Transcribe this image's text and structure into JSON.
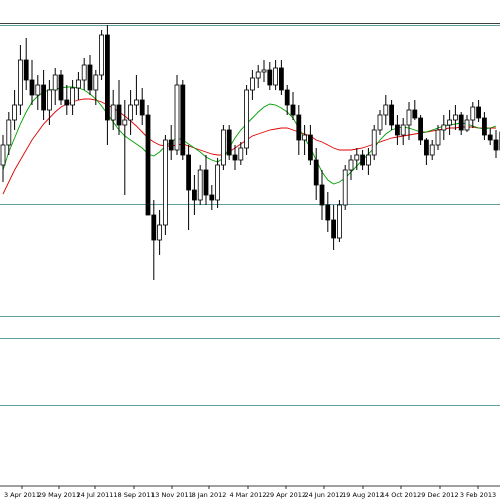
{
  "chart_data": {
    "type": "candlestick",
    "title": "",
    "xlabel": "",
    "ylabel": "",
    "grid": false,
    "legend": "none",
    "indicators": [
      {
        "kind": "moving-average",
        "color": "#00a000"
      },
      {
        "kind": "moving-average",
        "color": "#e00000"
      }
    ],
    "x_tick_labels": [
      "3 Apr 2011",
      "29 May 2011",
      "24 Jul 2011",
      "18 Sep 2011",
      "13 Nov 2011",
      "8 Jan 2012",
      "4 Mar 2012",
      "29 Apr 2012",
      "24 Jun 2012",
      "19 Aug 2012",
      "14 Oct 2012",
      "9 Dec 2012",
      "3 Feb 2013"
    ],
    "ylim": [
      0,
      500
    ],
    "panel_levels": [
      477,
      475,
      296,
      184,
      162,
      95
    ],
    "candles": [
      {
        "o": 335,
        "h": 365,
        "l": 318,
        "c": 355
      },
      {
        "o": 355,
        "h": 388,
        "l": 345,
        "c": 380
      },
      {
        "o": 380,
        "h": 410,
        "l": 370,
        "c": 395
      },
      {
        "o": 395,
        "h": 455,
        "l": 385,
        "c": 440
      },
      {
        "o": 440,
        "h": 462,
        "l": 410,
        "c": 420
      },
      {
        "o": 420,
        "h": 440,
        "l": 395,
        "c": 405
      },
      {
        "o": 405,
        "h": 425,
        "l": 390,
        "c": 415
      },
      {
        "o": 415,
        "h": 430,
        "l": 380,
        "c": 390
      },
      {
        "o": 390,
        "h": 420,
        "l": 375,
        "c": 410
      },
      {
        "o": 410,
        "h": 432,
        "l": 395,
        "c": 425
      },
      {
        "o": 425,
        "h": 430,
        "l": 395,
        "c": 400
      },
      {
        "o": 400,
        "h": 415,
        "l": 385,
        "c": 395
      },
      {
        "o": 395,
        "h": 420,
        "l": 385,
        "c": 412
      },
      {
        "o": 412,
        "h": 428,
        "l": 400,
        "c": 420
      },
      {
        "o": 420,
        "h": 442,
        "l": 410,
        "c": 435
      },
      {
        "o": 435,
        "h": 445,
        "l": 405,
        "c": 410
      },
      {
        "o": 410,
        "h": 430,
        "l": 395,
        "c": 425
      },
      {
        "o": 425,
        "h": 470,
        "l": 420,
        "c": 465
      },
      {
        "o": 465,
        "h": 475,
        "l": 355,
        "c": 380
      },
      {
        "o": 380,
        "h": 410,
        "l": 370,
        "c": 395
      },
      {
        "o": 395,
        "h": 420,
        "l": 365,
        "c": 375
      },
      {
        "o": 375,
        "h": 400,
        "l": 305,
        "c": 380
      },
      {
        "o": 380,
        "h": 410,
        "l": 365,
        "c": 395
      },
      {
        "o": 395,
        "h": 425,
        "l": 385,
        "c": 400
      },
      {
        "o": 400,
        "h": 412,
        "l": 375,
        "c": 385
      },
      {
        "o": 385,
        "h": 395,
        "l": 295,
        "c": 285
      },
      {
        "o": 285,
        "h": 300,
        "l": 220,
        "c": 260
      },
      {
        "o": 260,
        "h": 290,
        "l": 245,
        "c": 275
      },
      {
        "o": 275,
        "h": 365,
        "l": 265,
        "c": 360
      },
      {
        "o": 360,
        "h": 375,
        "l": 340,
        "c": 350
      },
      {
        "o": 350,
        "h": 425,
        "l": 345,
        "c": 415
      },
      {
        "o": 415,
        "h": 420,
        "l": 340,
        "c": 345
      },
      {
        "o": 345,
        "h": 355,
        "l": 270,
        "c": 310
      },
      {
        "o": 310,
        "h": 325,
        "l": 285,
        "c": 300
      },
      {
        "o": 300,
        "h": 335,
        "l": 295,
        "c": 330
      },
      {
        "o": 330,
        "h": 345,
        "l": 295,
        "c": 305
      },
      {
        "o": 305,
        "h": 315,
        "l": 290,
        "c": 300
      },
      {
        "o": 300,
        "h": 342,
        "l": 292,
        "c": 335
      },
      {
        "o": 335,
        "h": 375,
        "l": 330,
        "c": 370
      },
      {
        "o": 370,
        "h": 375,
        "l": 340,
        "c": 345
      },
      {
        "o": 345,
        "h": 355,
        "l": 330,
        "c": 340
      },
      {
        "o": 340,
        "h": 358,
        "l": 335,
        "c": 352
      },
      {
        "o": 352,
        "h": 415,
        "l": 345,
        "c": 410
      },
      {
        "o": 410,
        "h": 430,
        "l": 400,
        "c": 422
      },
      {
        "o": 422,
        "h": 435,
        "l": 412,
        "c": 428
      },
      {
        "o": 428,
        "h": 440,
        "l": 418,
        "c": 430
      },
      {
        "o": 430,
        "h": 438,
        "l": 410,
        "c": 415
      },
      {
        "o": 415,
        "h": 440,
        "l": 410,
        "c": 432
      },
      {
        "o": 432,
        "h": 440,
        "l": 405,
        "c": 410
      },
      {
        "o": 410,
        "h": 415,
        "l": 385,
        "c": 395
      },
      {
        "o": 395,
        "h": 408,
        "l": 380,
        "c": 385
      },
      {
        "o": 385,
        "h": 395,
        "l": 345,
        "c": 360
      },
      {
        "o": 360,
        "h": 375,
        "l": 345,
        "c": 365
      },
      {
        "o": 365,
        "h": 375,
        "l": 335,
        "c": 340
      },
      {
        "o": 340,
        "h": 352,
        "l": 300,
        "c": 315
      },
      {
        "o": 315,
        "h": 330,
        "l": 280,
        "c": 295
      },
      {
        "o": 295,
        "h": 308,
        "l": 268,
        "c": 280
      },
      {
        "o": 280,
        "h": 295,
        "l": 250,
        "c": 262
      },
      {
        "o": 262,
        "h": 300,
        "l": 258,
        "c": 295
      },
      {
        "o": 295,
        "h": 335,
        "l": 290,
        "c": 330
      },
      {
        "o": 330,
        "h": 345,
        "l": 320,
        "c": 340
      },
      {
        "o": 340,
        "h": 352,
        "l": 330,
        "c": 345
      },
      {
        "o": 345,
        "h": 350,
        "l": 330,
        "c": 335
      },
      {
        "o": 335,
        "h": 352,
        "l": 325,
        "c": 345
      },
      {
        "o": 345,
        "h": 375,
        "l": 340,
        "c": 370
      },
      {
        "o": 370,
        "h": 390,
        "l": 365,
        "c": 385
      },
      {
        "o": 385,
        "h": 405,
        "l": 375,
        "c": 395
      },
      {
        "o": 395,
        "h": 400,
        "l": 370,
        "c": 375
      },
      {
        "o": 375,
        "h": 385,
        "l": 355,
        "c": 365
      },
      {
        "o": 365,
        "h": 382,
        "l": 355,
        "c": 375
      },
      {
        "o": 375,
        "h": 398,
        "l": 360,
        "c": 390
      },
      {
        "o": 390,
        "h": 400,
        "l": 380,
        "c": 382
      },
      {
        "o": 382,
        "h": 385,
        "l": 355,
        "c": 360
      },
      {
        "o": 360,
        "h": 362,
        "l": 335,
        "c": 345
      },
      {
        "o": 345,
        "h": 360,
        "l": 340,
        "c": 355
      },
      {
        "o": 355,
        "h": 375,
        "l": 350,
        "c": 370
      },
      {
        "o": 370,
        "h": 385,
        "l": 360,
        "c": 375
      },
      {
        "o": 375,
        "h": 390,
        "l": 365,
        "c": 380
      },
      {
        "o": 380,
        "h": 395,
        "l": 370,
        "c": 385
      },
      {
        "o": 385,
        "h": 388,
        "l": 365,
        "c": 370
      },
      {
        "o": 370,
        "h": 385,
        "l": 368,
        "c": 380
      },
      {
        "o": 380,
        "h": 398,
        "l": 372,
        "c": 393
      },
      {
        "o": 393,
        "h": 400,
        "l": 378,
        "c": 382
      },
      {
        "o": 382,
        "h": 388,
        "l": 360,
        "c": 365
      },
      {
        "o": 365,
        "h": 372,
        "l": 355,
        "c": 360
      },
      {
        "o": 360,
        "h": 370,
        "l": 342,
        "c": 350
      },
      {
        "o": 350,
        "h": 372,
        "l": 345,
        "c": 368
      },
      {
        "o": 368,
        "h": 392,
        "l": 362,
        "c": 388
      }
    ],
    "ma_green": [
      330,
      348,
      362,
      376,
      388,
      398,
      404,
      408,
      410,
      411,
      412,
      413,
      413,
      412,
      410,
      406,
      401,
      394,
      386,
      378,
      370,
      364,
      360,
      356,
      352,
      346,
      344,
      348,
      354,
      358,
      362,
      360,
      356,
      352,
      348,
      343,
      340,
      338,
      342,
      352,
      362,
      370,
      376,
      382,
      388,
      393,
      396,
      395,
      392,
      388,
      382,
      372,
      362,
      352,
      340,
      328,
      320,
      316,
      318,
      322,
      328,
      334,
      340,
      346,
      352,
      360,
      366,
      370,
      372,
      373,
      372,
      370,
      368,
      368,
      370,
      372,
      374,
      375,
      376,
      377,
      376,
      374,
      372,
      371,
      372,
      374
    ],
    "ma_red": [
      306,
      318,
      330,
      340,
      350,
      360,
      368,
      376,
      382,
      388,
      393,
      396,
      398,
      400,
      401,
      401,
      400,
      398,
      395,
      392,
      388,
      384,
      379,
      374,
      368,
      362,
      358,
      355,
      354,
      354,
      355,
      356,
      354,
      352,
      350,
      348,
      346,
      345,
      345,
      348,
      352,
      356,
      360,
      364,
      366,
      368,
      370,
      371,
      372,
      372,
      370,
      368,
      366,
      364,
      360,
      358,
      355,
      352,
      350,
      350,
      350,
      351,
      352,
      354,
      356,
      358,
      360,
      362,
      363,
      364,
      365,
      366,
      367,
      368,
      369,
      370,
      371,
      372,
      372,
      373,
      373,
      373,
      372,
      372,
      372,
      372
    ]
  }
}
